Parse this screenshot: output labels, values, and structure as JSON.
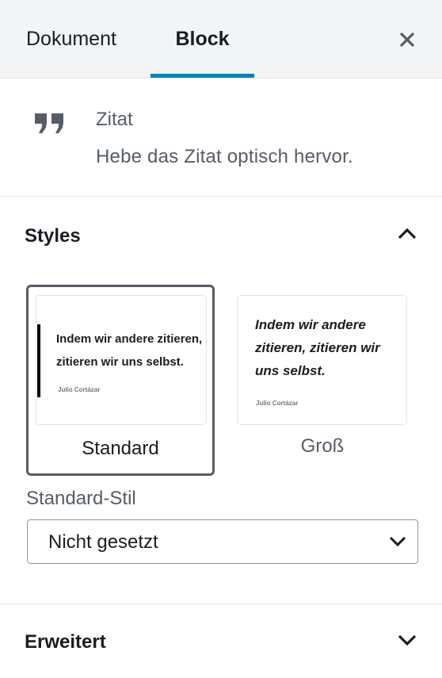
{
  "tabs": {
    "document_label": "Dokument",
    "block_label": "Block",
    "active": "Block",
    "accent_color": "#0085ba"
  },
  "close_icon": "close-icon",
  "block_card": {
    "icon": "quote-icon",
    "title": "Zitat",
    "description": "Hebe das Zitat optisch hervor."
  },
  "styles_panel": {
    "title": "Styles",
    "expanded": true,
    "toggle_icon": "chevron-up-icon",
    "options": [
      {
        "label": "Standard",
        "selected": true,
        "preview_quote": "Indem wir andere zitieren, zitieren wir uns selbst.",
        "preview_cite": "Julio Cortázar"
      },
      {
        "label": "Groß",
        "selected": false,
        "preview_quote": "Indem wir andere zitieren, zitieren wir uns selbst.",
        "preview_cite": "Julio Cortázar"
      }
    ],
    "default_style": {
      "label": "Standard-Stil",
      "value": "Nicht gesetzt",
      "icon": "chevron-down-icon"
    }
  },
  "advanced_panel": {
    "title": "Erweitert",
    "expanded": false,
    "toggle_icon": "chevron-down-icon"
  }
}
